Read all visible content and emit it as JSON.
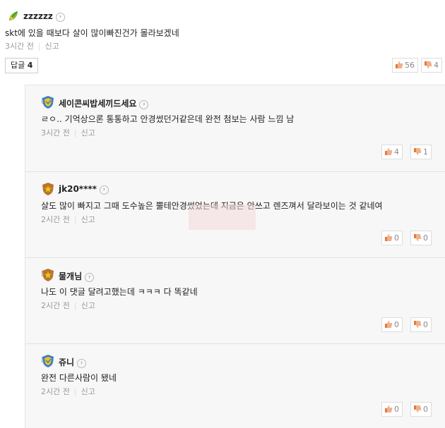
{
  "main_comment": {
    "username": "zzzzzz",
    "text": "skt에 있을 때보다 살이 많이빠진건가 몰라보겠네",
    "time": "3시간 전",
    "report": "신고",
    "likes": "56",
    "dislikes": "4"
  },
  "reply_button": {
    "label": "답글",
    "count": "4"
  },
  "replies": [
    {
      "username": "세이콘씨밥세끼드세요",
      "text": "ㄹㅇ.. 기억상으론 통통하고 안경썼던거같은데 완전 첨보는 사람 느낌 남",
      "time": "3시간 전",
      "report": "신고",
      "likes": "4",
      "dislikes": "1",
      "badge_color": "#3b7ec9"
    },
    {
      "username": "jk20****",
      "text": "살도 많이 빠지고 그때 도수높은 뿔테안경썼었는데 지금은 안쓰고 렌즈껴서 달라보이는 것 같네여",
      "time": "2시간 전",
      "report": "신고",
      "likes": "0",
      "dislikes": "0",
      "badge_color": "#b8752d"
    },
    {
      "username": "물개님",
      "text": "나도 이 댓글 달려고했는데 ㅋㅋㅋ 다 똑같네",
      "time": "2시간 전",
      "report": "신고",
      "likes": "0",
      "dislikes": "0",
      "badge_color": "#b8752d"
    },
    {
      "username": "쥬니",
      "text": "완전 다른사람이 됐네",
      "time": "2시간 전",
      "report": "신고",
      "likes": "0",
      "dislikes": "0",
      "badge_color": "#3b7ec9"
    }
  ]
}
